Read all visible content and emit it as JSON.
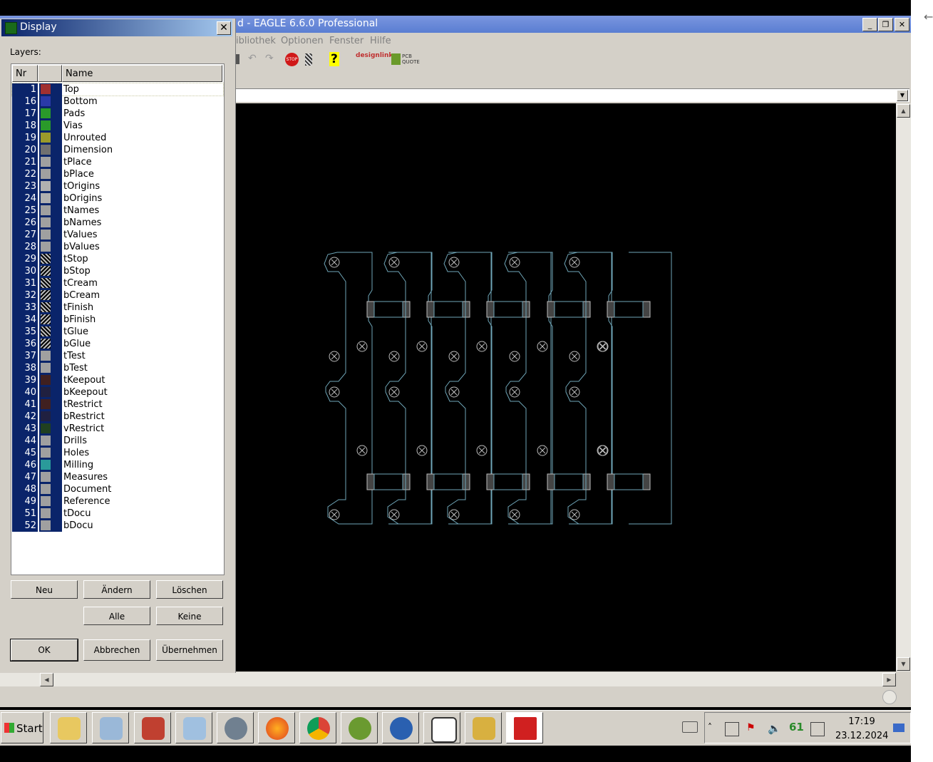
{
  "main_window": {
    "title": "d - EAGLE 6.6.0 Professional",
    "menu": [
      "ibliothek",
      "Optionen",
      "Fenster",
      "Hilfe"
    ],
    "toolbar": {
      "stop_label": "STOP",
      "help_label": "?",
      "designlink_label": "designlink",
      "pcbquote_label": "PCB QUOTE"
    }
  },
  "dialog": {
    "title": "Display",
    "layers_label": "Layers:",
    "columns": {
      "nr": "Nr",
      "color": "",
      "name": "Name"
    },
    "layers": [
      {
        "nr": "1",
        "name": "Top",
        "color": "#a03030",
        "pattern": "solid"
      },
      {
        "nr": "16",
        "name": "Bottom",
        "color": "#2a3aa8",
        "pattern": "solid"
      },
      {
        "nr": "17",
        "name": "Pads",
        "color": "#2a9a2a",
        "pattern": "solid"
      },
      {
        "nr": "18",
        "name": "Vias",
        "color": "#2a9a2a",
        "pattern": "solid"
      },
      {
        "nr": "19",
        "name": "Unrouted",
        "color": "#9a9a2a",
        "pattern": "solid"
      },
      {
        "nr": "20",
        "name": "Dimension",
        "color": "#707070",
        "pattern": "solid"
      },
      {
        "nr": "21",
        "name": "tPlace",
        "color": "#a0a0a0",
        "pattern": "solid"
      },
      {
        "nr": "22",
        "name": "bPlace",
        "color": "#a0a0a0",
        "pattern": "solid"
      },
      {
        "nr": "23",
        "name": "tOrigins",
        "color": "#b0b0b0",
        "pattern": "solid"
      },
      {
        "nr": "24",
        "name": "bOrigins",
        "color": "#b0b0b0",
        "pattern": "solid"
      },
      {
        "nr": "25",
        "name": "tNames",
        "color": "#a0a0a0",
        "pattern": "solid"
      },
      {
        "nr": "26",
        "name": "bNames",
        "color": "#a0a0a0",
        "pattern": "solid"
      },
      {
        "nr": "27",
        "name": "tValues",
        "color": "#a0a0a0",
        "pattern": "solid"
      },
      {
        "nr": "28",
        "name": "bValues",
        "color": "#a0a0a0",
        "pattern": "solid"
      },
      {
        "nr": "29",
        "name": "tStop",
        "color": "#808080",
        "pattern": "hatch"
      },
      {
        "nr": "30",
        "name": "bStop",
        "color": "#808080",
        "pattern": "hatchb"
      },
      {
        "nr": "31",
        "name": "tCream",
        "color": "#808080",
        "pattern": "hatch"
      },
      {
        "nr": "32",
        "name": "bCream",
        "color": "#808080",
        "pattern": "hatchb"
      },
      {
        "nr": "33",
        "name": "tFinish",
        "color": "#808080",
        "pattern": "hatch"
      },
      {
        "nr": "34",
        "name": "bFinish",
        "color": "#808080",
        "pattern": "hatchb"
      },
      {
        "nr": "35",
        "name": "tGlue",
        "color": "#808080",
        "pattern": "hatch"
      },
      {
        "nr": "36",
        "name": "bGlue",
        "color": "#808080",
        "pattern": "hatchb"
      },
      {
        "nr": "37",
        "name": "tTest",
        "color": "#a0a0a0",
        "pattern": "solid"
      },
      {
        "nr": "38",
        "name": "bTest",
        "color": "#a0a0a0",
        "pattern": "solid"
      },
      {
        "nr": "39",
        "name": "tKeepout",
        "color": "#402020",
        "pattern": "solid"
      },
      {
        "nr": "40",
        "name": "bKeepout",
        "color": "#202040",
        "pattern": "solid"
      },
      {
        "nr": "41",
        "name": "tRestrict",
        "color": "#402020",
        "pattern": "solid"
      },
      {
        "nr": "42",
        "name": "bRestrict",
        "color": "#202040",
        "pattern": "solid"
      },
      {
        "nr": "43",
        "name": "vRestrict",
        "color": "#204020",
        "pattern": "solid"
      },
      {
        "nr": "44",
        "name": "Drills",
        "color": "#a0a0a0",
        "pattern": "solid"
      },
      {
        "nr": "45",
        "name": "Holes",
        "color": "#a0a0a0",
        "pattern": "solid"
      },
      {
        "nr": "46",
        "name": "Milling",
        "color": "#2a9a9a",
        "pattern": "solid"
      },
      {
        "nr": "47",
        "name": "Measures",
        "color": "#a0a0a0",
        "pattern": "solid"
      },
      {
        "nr": "48",
        "name": "Document",
        "color": "#a0a0a0",
        "pattern": "solid"
      },
      {
        "nr": "49",
        "name": "Reference",
        "color": "#a0a0a0",
        "pattern": "solid"
      },
      {
        "nr": "51",
        "name": "tDocu",
        "color": "#a0a0a0",
        "pattern": "solid"
      },
      {
        "nr": "52",
        "name": "bDocu",
        "color": "#a0a0a0",
        "pattern": "solid"
      }
    ],
    "buttons": {
      "neu": "Neu",
      "aendern": "Ändern",
      "loeschen": "Löschen",
      "alle": "Alle",
      "keine": "Keine",
      "ok": "OK",
      "abbrechen": "Abbrechen",
      "uebernehmen": "Übernehmen"
    }
  },
  "taskbar": {
    "start_label": "Start",
    "tray_count": "61",
    "clock_time": "17:19",
    "clock_date": "23.12.2024"
  },
  "colors": {
    "board_outline": "#6fa6b8",
    "canvas_bg": "#000000",
    "selection": "#0a246a"
  }
}
